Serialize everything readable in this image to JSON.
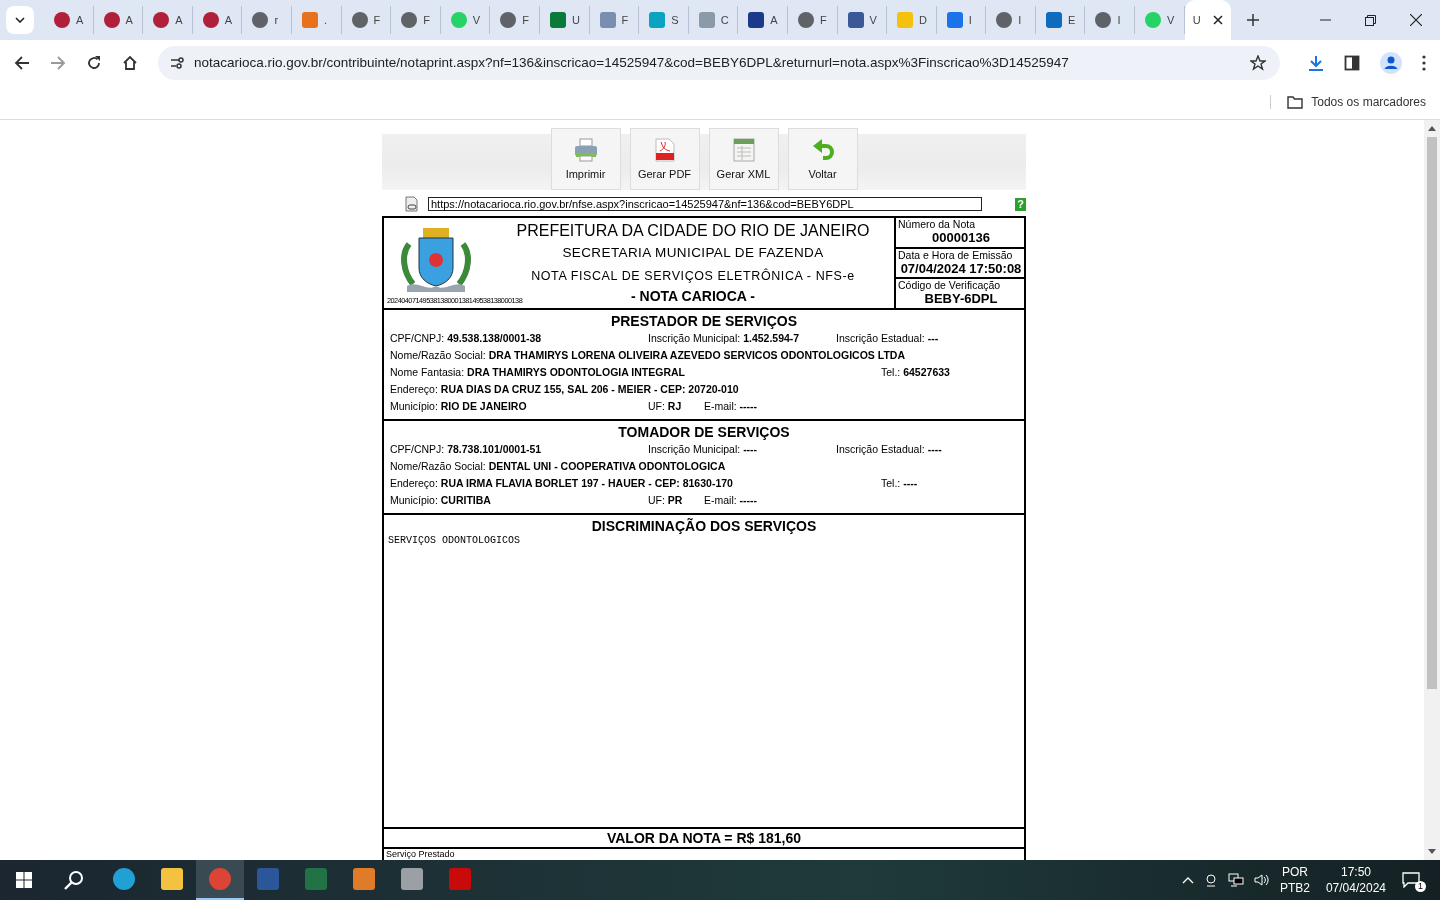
{
  "tabs": [
    {
      "label": "A",
      "kind": "target",
      "selected": false
    },
    {
      "label": "A",
      "kind": "target",
      "selected": false
    },
    {
      "label": "A",
      "kind": "target",
      "selected": false
    },
    {
      "label": "A",
      "kind": "target",
      "selected": false
    },
    {
      "label": "r",
      "kind": "globe",
      "selected": false
    },
    {
      "label": ".",
      "kind": "ring",
      "selected": false
    },
    {
      "label": "F",
      "kind": "globe",
      "selected": false
    },
    {
      "label": "F",
      "kind": "globe",
      "selected": false
    },
    {
      "label": "V",
      "kind": "chat",
      "selected": false
    },
    {
      "label": "F",
      "kind": "globe",
      "selected": false
    },
    {
      "label": "U",
      "kind": "tree",
      "selected": false
    },
    {
      "label": "F",
      "kind": "chart",
      "selected": false
    },
    {
      "label": "S",
      "kind": "square",
      "selected": false
    },
    {
      "label": "C",
      "kind": "card",
      "selected": false
    },
    {
      "label": "A",
      "kind": "letter",
      "selected": false
    },
    {
      "label": "F",
      "kind": "globe",
      "selected": false
    },
    {
      "label": "V",
      "kind": "tooth",
      "selected": false
    },
    {
      "label": "D",
      "kind": "badge",
      "selected": false
    },
    {
      "label": "I",
      "kind": "drive",
      "selected": false
    },
    {
      "label": "I",
      "kind": "globe",
      "selected": false
    },
    {
      "label": "E",
      "kind": "mail",
      "selected": false
    },
    {
      "label": "I",
      "kind": "globe",
      "selected": false
    },
    {
      "label": "V",
      "kind": "chat",
      "selected": false
    },
    {
      "label": "U",
      "kind": "blank",
      "selected": true
    }
  ],
  "address": "notacarioca.rio.gov.br/contribuinte/notaprint.aspx?nf=136&inscricao=14525947&cod=BEBY6DPL&returnurl=nota.aspx%3Finscricao%3D14525947",
  "bookmarks": "Todos os marcadores",
  "toolbar": [
    {
      "label": "Imprimir",
      "kind": "printer"
    },
    {
      "label": "Gerar PDF",
      "kind": "pdf"
    },
    {
      "label": "Gerar XML",
      "kind": "xml"
    },
    {
      "label": "Voltar",
      "kind": "back"
    }
  ],
  "link_url": "https://notacarioca.rio.gov.br/nfse.aspx?inscricao=14525947&nf=136&cod=BEBY6DPL",
  "help": "?",
  "header": {
    "lines": [
      "PREFEITURA DA CIDADE DO RIO DE JANEIRO",
      "SECRETARIA MUNICIPAL  DE  FAZENDA",
      "NOTA FISCAL DE SERVIÇOS ELETRÔNICA - NFS-e",
      "- NOTA CARIOCA -"
    ],
    "code_line": "20240407149538138000138149538138000138",
    "info": [
      {
        "label": "Número da Nota",
        "value": "00000136"
      },
      {
        "label": "Data e Hora de Emissão",
        "value": "07/04/2024 17:50:08"
      },
      {
        "label": "Código de Verificação",
        "value": "BEBY-6DPL"
      }
    ]
  },
  "sections": [
    {
      "title": "PRESTADOR DE SERVIÇOS",
      "rows": [
        [
          {
            "kind": "left",
            "label": "CPF/CNPJ:",
            "value": "49.538.138/0001-38"
          },
          {
            "kind": "middle",
            "label": "Inscrição Municipal:",
            "value": "1.452.594-7"
          },
          {
            "kind": "right",
            "label": "Inscrição Estadual:",
            "value": "---"
          }
        ],
        [
          {
            "kind": "left",
            "label": "Nome/Razão Social:",
            "value": "DRA THAMIRYS LORENA OLIVEIRA AZEVEDO SERVICOS ODONTOLOGICOS LTDA"
          }
        ],
        [
          {
            "kind": "left",
            "label": "Nome Fantasia:",
            "value": "DRA THAMIRYS ODONTOLOGIA INTEGRAL"
          },
          {
            "kind": "tel",
            "label": "Tel.:",
            "value": "64527633"
          }
        ],
        [
          {
            "kind": "left",
            "label": "Endereço:",
            "value": "RUA DIAS DA CRUZ 155, SAL 206 - MEIER - CEP: 20720-010"
          }
        ],
        [
          {
            "kind": "left",
            "label": "Município:",
            "value": "RIO DE JANEIRO"
          },
          {
            "kind": "middle",
            "label": "UF:",
            "value": "RJ"
          },
          {
            "kind": "email",
            "label": "E-mail:",
            "value": "-----"
          }
        ]
      ]
    },
    {
      "title": "TOMADOR DE SERVIÇOS",
      "rows": [
        [
          {
            "kind": "left",
            "label": "CPF/CNPJ:",
            "value": "78.738.101/0001-51"
          },
          {
            "kind": "middle",
            "label": "Inscrição Municipal:",
            "value": "----"
          },
          {
            "kind": "right",
            "label": "Inscrição Estadual:",
            "value": "----"
          }
        ],
        [
          {
            "kind": "left",
            "label": "Nome/Razão Social:",
            "value": "DENTAL UNI - COOPERATIVA ODONTOLOGICA"
          }
        ],
        [
          {
            "kind": "left",
            "label": "Endereço:",
            "value": "RUA IRMA FLAVIA BORLET 197 - HAUER - CEP: 81630-170"
          },
          {
            "kind": "tel",
            "label": "Tel.:",
            "value": "----"
          }
        ],
        [
          {
            "kind": "left",
            "label": "Município:",
            "value": "CURITIBA"
          },
          {
            "kind": "middle",
            "label": "UF:",
            "value": "PR"
          },
          {
            "kind": "email",
            "label": "E-mail:",
            "value": "-----"
          }
        ]
      ]
    }
  ],
  "discriminacao": {
    "title": "DISCRIMINAÇÃO DOS SERVIÇOS",
    "text": "SERVIÇOS ODONTOLOGICOS"
  },
  "valor": "VALOR DA NOTA = R$ 181,60",
  "servico_label": "Serviço Prestado",
  "taskbar": {
    "apps": [
      {
        "kind": "edge",
        "active": false
      },
      {
        "kind": "folder",
        "active": false
      },
      {
        "kind": "chrome",
        "active": true
      },
      {
        "kind": "word",
        "active": false
      },
      {
        "kind": "excel",
        "active": false
      },
      {
        "kind": "media",
        "active": false
      },
      {
        "kind": "printer",
        "active": false
      },
      {
        "kind": "acrobat",
        "active": false
      }
    ],
    "lang": "POR",
    "layout": "PTB2",
    "time": "17:50",
    "date": "07/04/2024",
    "notifications": "1"
  }
}
